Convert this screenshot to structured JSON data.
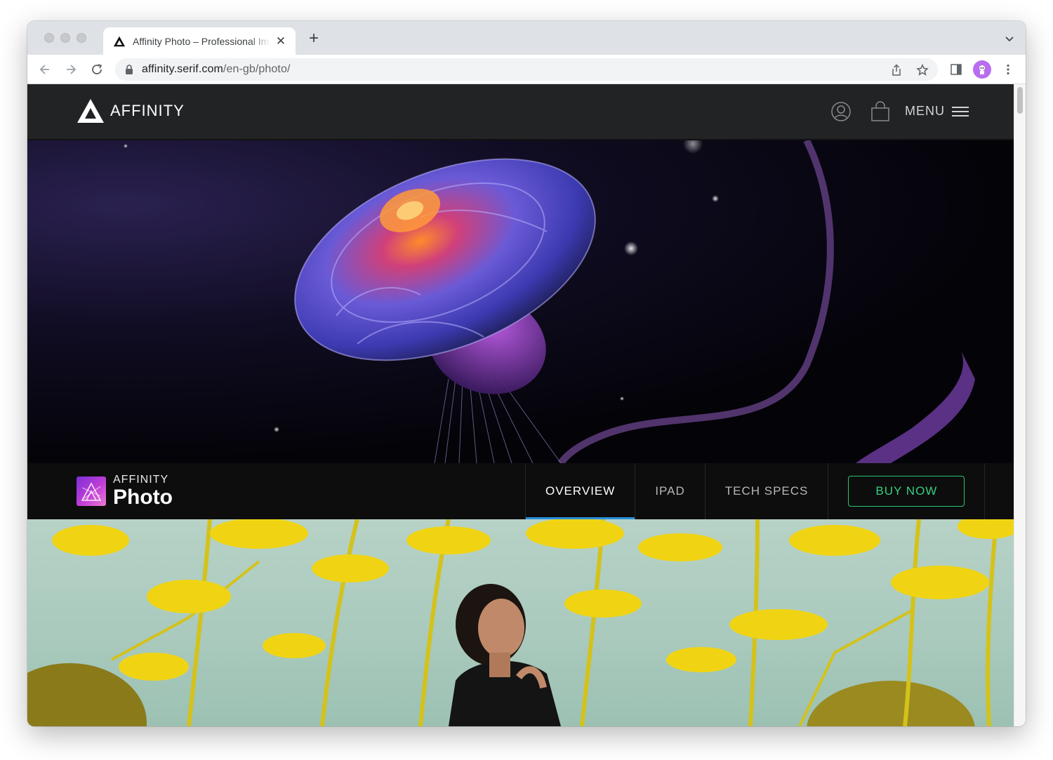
{
  "browser": {
    "tab_title": "Affinity Photo – Professional Image Editing Software",
    "url_host": "affinity.serif.com",
    "url_path": "/en-gb/photo/",
    "new_tab_symbol": "+",
    "close_symbol": "✕"
  },
  "site": {
    "brand": "AFFINITY",
    "menu_label": "MENU"
  },
  "product": {
    "kicker": "AFFINITY",
    "name": "Photo",
    "tabs": [
      "OVERVIEW",
      "IPAD",
      "TECH SPECS"
    ],
    "active_tab": "OVERVIEW",
    "buy_label": "BUY NOW"
  },
  "hero": {
    "subject": "jellyfish illustration"
  },
  "feature": {
    "subject": "woman among yellow flowers"
  },
  "colors": {
    "accent_green": "#28c76f",
    "active_tab_underline": "#2a8fd9",
    "header_bg": "#222325",
    "product_gradient": [
      "#7a2fd6",
      "#ec7ad3"
    ]
  },
  "icons": [
    "affinity-favicon-icon",
    "close-icon",
    "plus-icon",
    "chevron-down-icon",
    "back-icon",
    "forward-icon",
    "reload-icon",
    "lock-icon",
    "share-icon",
    "star-icon",
    "side-panel-icon",
    "more-icon",
    "user-icon",
    "bag-icon",
    "hamburger-icon"
  ]
}
